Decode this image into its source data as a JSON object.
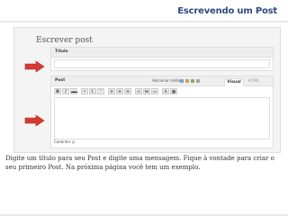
{
  "slide": {
    "title": "Escrevendo um Post",
    "caption": "Digite um título para seu Post e digite uma mensagem. Fique à vontade para criar o seu primeiro Post. Na próxima página você tem um exemplo."
  },
  "editor_screenshot": {
    "page_heading": "Escrever post",
    "title_box": {
      "label": "Título",
      "value": ""
    },
    "post_box": {
      "label": "Post",
      "media_label": "Adicionar mídia",
      "tabs": [
        "Visual",
        "HTML"
      ],
      "active_tab": "Visual",
      "toolbar_buttons": [
        "B",
        "I",
        "ABC",
        "•",
        "1.",
        "“",
        "≡",
        "≡",
        "≡",
        "∞",
        "⋈",
        "▭",
        "A",
        "▦"
      ],
      "content": "",
      "path_label": "Caminho: p"
    },
    "media_icon_colors": [
      "#7aa0c8",
      "#c8a060",
      "#8aa66a",
      "#a0a0a0"
    ]
  },
  "colors": {
    "arrow": "#d63b2f",
    "title": "#2f4a80"
  }
}
